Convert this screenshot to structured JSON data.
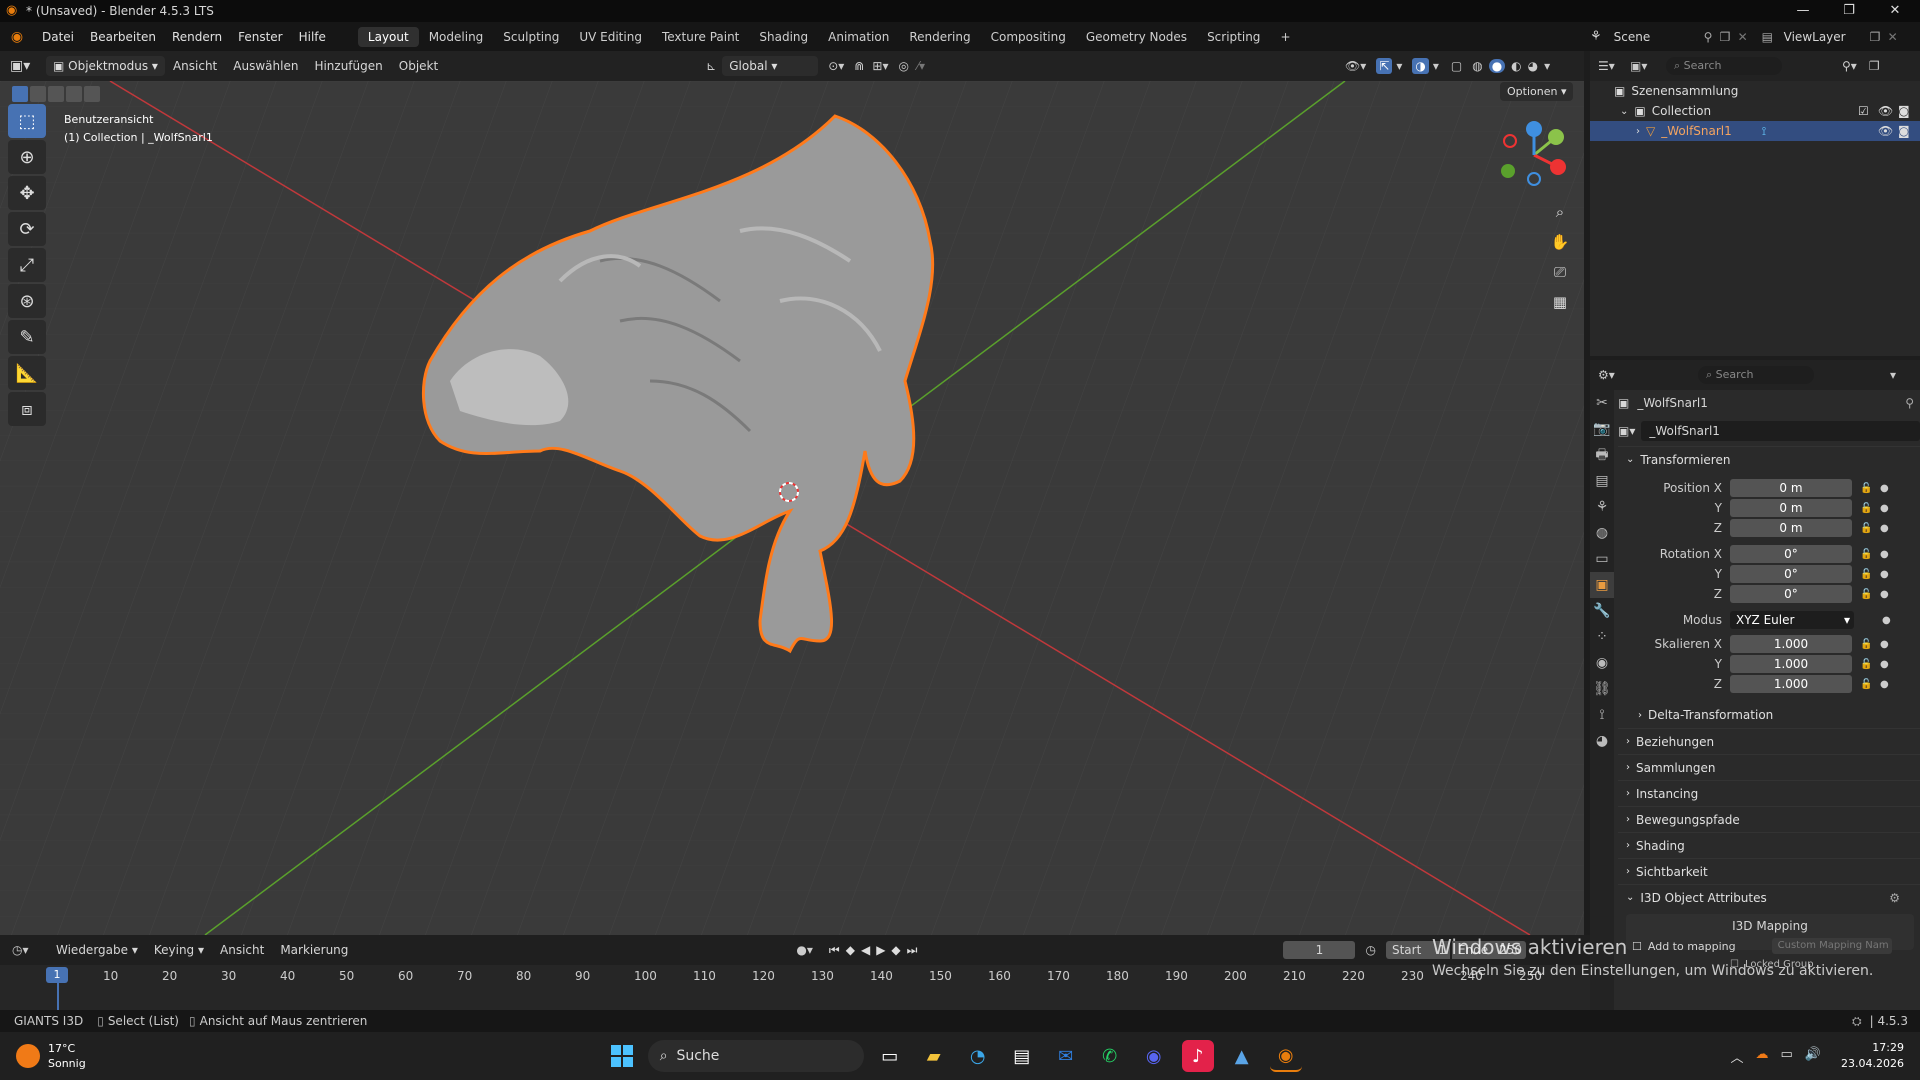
{
  "window": {
    "title": "* (Unsaved) - Blender 4.5.3 LTS"
  },
  "menu": [
    "Datei",
    "Bearbeiten",
    "Rendern",
    "Fenster",
    "Hilfe"
  ],
  "workspaces": [
    "Layout",
    "Modeling",
    "Sculpting",
    "UV Editing",
    "Texture Paint",
    "Shading",
    "Animation",
    "Rendering",
    "Compositing",
    "Geometry Nodes",
    "Scripting"
  ],
  "scene": {
    "name": "Scene",
    "view_layer": "ViewLayer"
  },
  "viewport_header": {
    "mode": "Objektmodus",
    "menus": [
      "Ansicht",
      "Auswählen",
      "Hinzufügen",
      "Objekt"
    ],
    "orientation": "Global",
    "options": "Optionen"
  },
  "viewport": {
    "view_name": "Benutzeransicht",
    "collection_info": "(1) Collection | _WolfSnarl1"
  },
  "outliner": {
    "search_placeholder": "Search",
    "scene_collection": "Szenensammlung",
    "collection": "Collection",
    "object": "_WolfSnarl1"
  },
  "properties": {
    "search_placeholder": "Search",
    "object_name": "_WolfSnarl1",
    "data_name": "_WolfSnarl1",
    "transform_title": "Transformieren",
    "position": {
      "label": "Position X",
      "x": "0 m",
      "y": "0 m",
      "z": "0 m"
    },
    "rotation": {
      "label": "Rotation X",
      "x": "0°",
      "y": "0°",
      "z": "0°"
    },
    "mode_label": "Modus",
    "mode_value": "XYZ Euler",
    "scale": {
      "label": "Skalieren X",
      "x": "1.000",
      "y": "1.000",
      "z": "1.000"
    },
    "axis_y": "Y",
    "axis_z": "Z",
    "delta": "Delta-Transformation",
    "sections": [
      "Beziehungen",
      "Sammlungen",
      "Instancing",
      "Bewegungspfade",
      "Shading",
      "Sichtbarkeit"
    ],
    "i3d": {
      "title": "I3D Object Attributes",
      "mapping_label": "I3D Mapping",
      "add_to_mapping": "Add to mapping",
      "mapping_placeholder": "Custom Mapping Nam",
      "locked_group": "Locked Group"
    }
  },
  "timeline": {
    "menus": [
      "Wiedergabe",
      "Keying",
      "Ansicht",
      "Markierung"
    ],
    "current_frame": "1",
    "start_label": "Start",
    "start_value": "1",
    "end_label": "Ende",
    "end_value": "250",
    "ticks": [
      "10",
      "20",
      "30",
      "40",
      "50",
      "60",
      "70",
      "80",
      "90",
      "100",
      "110",
      "120",
      "130",
      "140",
      "150",
      "160",
      "170",
      "180",
      "190",
      "200",
      "210",
      "220",
      "230",
      "240",
      "250"
    ]
  },
  "status": {
    "addon": "GIANTS I3D",
    "select_hint": "Select (List)",
    "center_hint": "Ansicht auf Maus zentrieren",
    "version": "4.5.3"
  },
  "watermark": {
    "line1": "Windows aktivieren",
    "line2": "Wechseln Sie zu den Einstellungen, um Windows zu aktivieren."
  },
  "taskbar": {
    "temperature": "17°C",
    "weather": "Sonnig",
    "search": "Suche",
    "time": "17:29",
    "date": "23.04.2026"
  }
}
